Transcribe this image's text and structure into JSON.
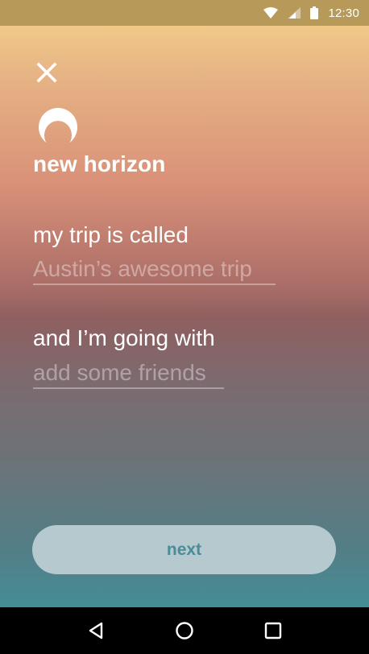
{
  "status_bar": {
    "time": "12:30",
    "icons": [
      "wifi-icon",
      "cell-signal-icon",
      "battery-icon"
    ],
    "background": "#b79a5a"
  },
  "header": {
    "close_icon": "close-icon",
    "logo_icon": "moon-horizon-logo",
    "title": "new horizon"
  },
  "form": {
    "trip_prompt": "my trip is called",
    "trip_name_placeholder": "Austin’s awesome trip",
    "companions_prompt": "and I’m going with",
    "companions_placeholder": "add some friends"
  },
  "actions": {
    "next_label": "next",
    "button_color": "#b5c9ce",
    "text_color": "#4b8c99"
  },
  "nav_bar": {
    "icons": [
      "back-icon",
      "home-icon",
      "recents-icon"
    ]
  }
}
